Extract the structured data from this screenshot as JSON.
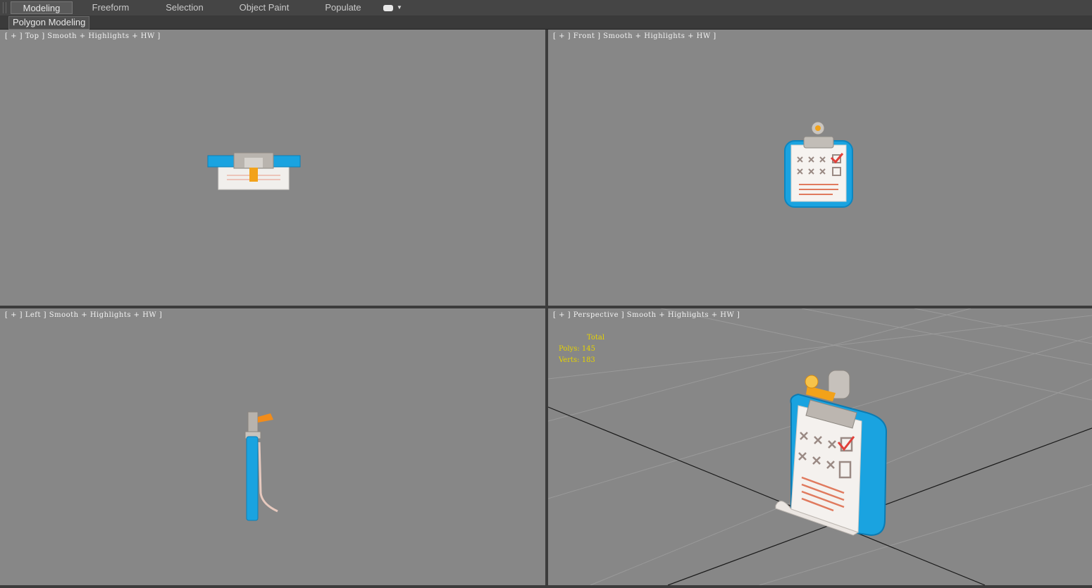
{
  "ribbon": {
    "tabs": [
      "Modeling",
      "Freeform",
      "Selection",
      "Object Paint",
      "Populate"
    ],
    "active_tab": "Modeling",
    "sub_tab": "Polygon Modeling"
  },
  "viewports": {
    "top": {
      "label": "[ + ] Top ] Smooth + Highlights + HW ]"
    },
    "front": {
      "label": "[ + ] Front ] Smooth + Highlights + HW ]"
    },
    "left": {
      "label": "[ + ] Left ] Smooth + Highlights + HW ]"
    },
    "perspective": {
      "label": "[ + ] Perspective ] Smooth + Highlights + HW ]",
      "stats": {
        "header": "Total",
        "polys": "Polys: 145",
        "verts": "Verts: 183"
      }
    }
  },
  "colors": {
    "viewport_bg": "#878787",
    "stats_text": "#e6d300",
    "board_blue": "#1aa3e0",
    "paper": "#f4f1ee",
    "mark": "#e05a3a"
  }
}
